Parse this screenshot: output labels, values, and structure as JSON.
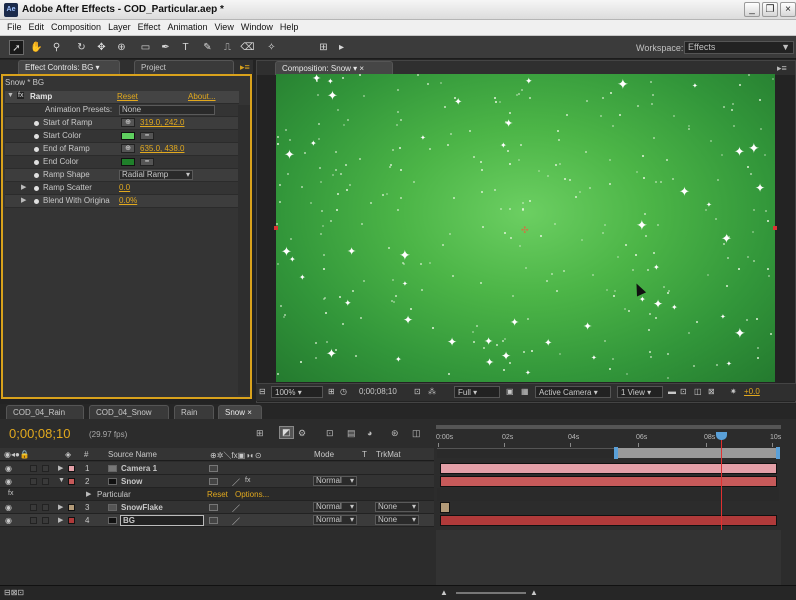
{
  "window": {
    "title": "Adobe After Effects - COD_Particular.aep *",
    "app_icon": "Ae"
  },
  "menu": [
    "File",
    "Edit",
    "Composition",
    "Layer",
    "Effect",
    "Animation",
    "View",
    "Window",
    "Help"
  ],
  "toolbar": {
    "workspace_label": "Workspace:",
    "workspace_value": "Effects"
  },
  "effect_controls": {
    "tab_label": "Effect Controls: BG",
    "project_tab": "Project",
    "breadcrumb": "Snow * BG",
    "effect_name": "Ramp",
    "fx_badge": "fx",
    "reset": "Reset",
    "about": "About...",
    "presets_label": "Animation Presets:",
    "presets_value": "None",
    "rows": [
      {
        "label": "Start of Ramp",
        "value": "319.0, 242.0",
        "kind": "point"
      },
      {
        "label": "Start Color",
        "value": "",
        "kind": "color",
        "color": "#5fcf5f"
      },
      {
        "label": "End of Ramp",
        "value": "635.0, 438.0",
        "kind": "point"
      },
      {
        "label": "End Color",
        "value": "",
        "kind": "color",
        "color": "#1f7f2a"
      },
      {
        "label": "Ramp Shape",
        "value": "Radial Ramp",
        "kind": "dropdown"
      },
      {
        "label": "Ramp Scatter",
        "value": "0.0",
        "kind": "value"
      },
      {
        "label": "Blend With Origina",
        "value": "0.0%",
        "kind": "value"
      }
    ]
  },
  "composition": {
    "tab_label": "Composition: Snow",
    "zoom": "100%",
    "timecode": "0;00;08;10",
    "resolution": "Full",
    "camera": "Active Camera",
    "view": "1 View",
    "exposure": "+0.0"
  },
  "timeline": {
    "tabs": [
      "COD_04_Rain",
      "COD_04_Snow",
      "Rain",
      "Snow"
    ],
    "active_tab": "Snow",
    "timecode": "0;00;08;10",
    "fps": "(29.97 fps)",
    "headers": {
      "source": "Source Name",
      "mode": "Mode",
      "t": "T",
      "trkmat": "TrkMat"
    },
    "ticks": [
      "0:00s",
      "02s",
      "04s",
      "06s",
      "08s",
      "10s"
    ],
    "layers": [
      {
        "num": "1",
        "name": "Camera 1",
        "mode": "",
        "trkmat": "",
        "color": "#e4a0a8"
      },
      {
        "num": "2",
        "name": "Snow",
        "mode": "Normal",
        "trkmat": "",
        "color": "#c75a5a"
      },
      {
        "num": "",
        "name": "Particular",
        "mode": "",
        "trkmat": "",
        "color": "",
        "reset": "Reset",
        "options": "Options..."
      },
      {
        "num": "3",
        "name": "SnowFlake",
        "mode": "Normal",
        "trkmat": "None",
        "color": "#b29a78"
      },
      {
        "num": "4",
        "name": "BG",
        "mode": "Normal",
        "trkmat": "None",
        "color": "#b03a3a"
      }
    ]
  },
  "colors": {
    "accent": "#e2a91e",
    "panel_border": "#d9a21c",
    "cti": "#e03030"
  },
  "icons": [
    "selection-tool-icon",
    "hand-tool-icon",
    "zoom-tool-icon",
    "rotate-tool-icon",
    "camera-tool-icon",
    "pan-behind-icon",
    "rectangle-mask-icon",
    "pen-tool-icon",
    "type-tool-icon",
    "brush-icon",
    "clone-stamp-icon",
    "eraser-icon",
    "puppet-pin-icon"
  ]
}
